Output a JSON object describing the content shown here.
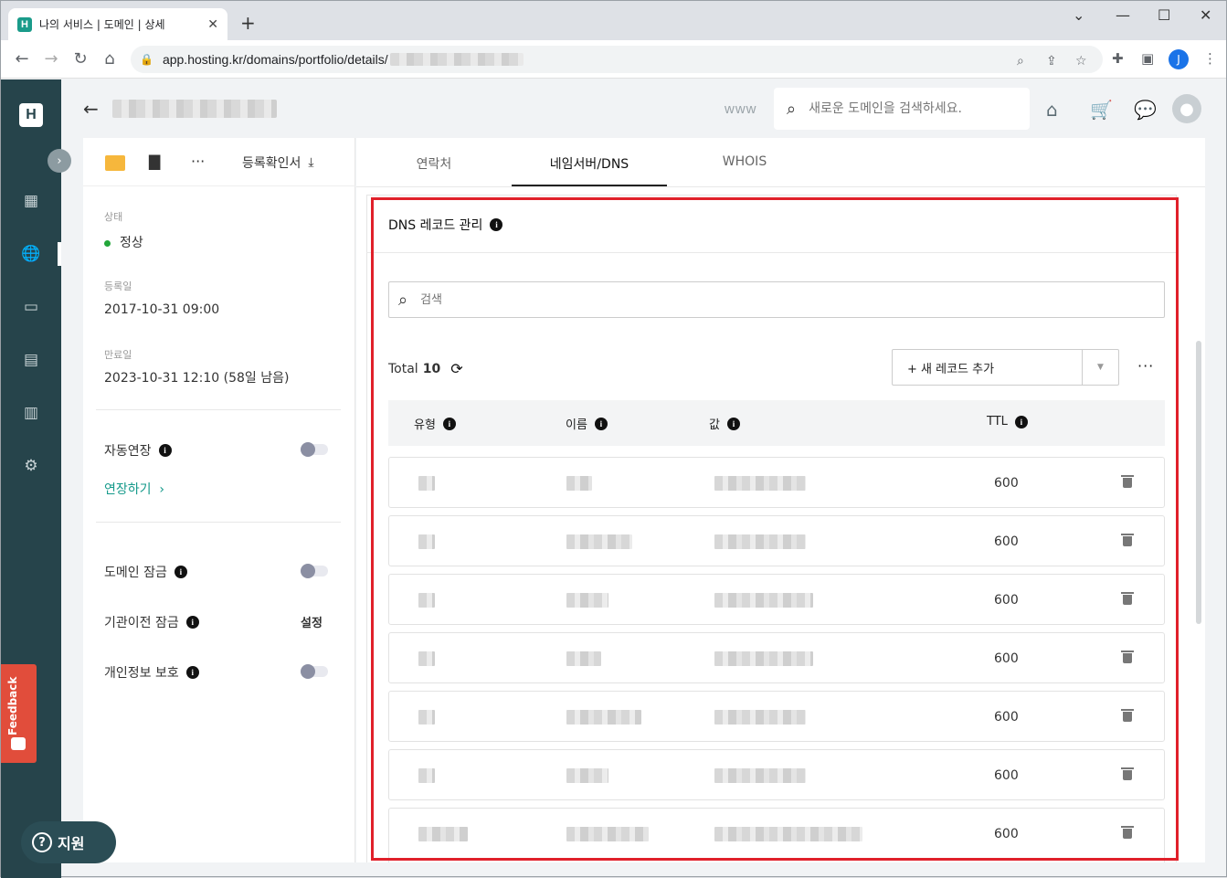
{
  "browser": {
    "tab_title": "나의 서비스 | 도메인 | 상세",
    "url": "app.hosting.kr/domains/portfolio/details/",
    "profile_initial": "J"
  },
  "header": {
    "www_label": "www",
    "search_placeholder": "새로운 도메인을 검색하세요."
  },
  "left_panel": {
    "cert_label": "등록확인서",
    "status_label": "상태",
    "status_value": "정상",
    "registered_label": "등록일",
    "registered_value": "2017-10-31 09:00",
    "expiry_label": "만료일",
    "expiry_value": "2023-10-31 12:10 (58일 남음)",
    "auto_renew_label": "자동연장",
    "renew_link": "연장하기",
    "domain_lock_label": "도메인 잠금",
    "transfer_lock_label": "기관이전 잠금",
    "transfer_lock_action": "설정",
    "privacy_label": "개인정보 보호"
  },
  "tabs": [
    {
      "label": "연락처"
    },
    {
      "label": "네임서버/DNS"
    },
    {
      "label": "WHOIS"
    }
  ],
  "dns": {
    "title": "DNS 레코드 관리",
    "search_placeholder": "검색",
    "total_label": "Total",
    "total_count": "10",
    "add_record_label": "+ 새 레코드 추가",
    "columns": {
      "type": "유형",
      "name": "이름",
      "value": "값",
      "ttl": "TTL"
    },
    "rows": [
      {
        "ttl": "600"
      },
      {
        "ttl": "600"
      },
      {
        "ttl": "600"
      },
      {
        "ttl": "600"
      },
      {
        "ttl": "600"
      },
      {
        "ttl": "600"
      },
      {
        "ttl": "600"
      }
    ]
  },
  "sidebar": {
    "logo": "H",
    "feedback_label": "Feedback",
    "support_label": "지원"
  },
  "colors": {
    "sidebar_bg": "#26444b",
    "accent": "#14998a",
    "highlight_border": "#e0202a",
    "status_green": "#22a63a",
    "feedback_red": "#e14d3b"
  }
}
